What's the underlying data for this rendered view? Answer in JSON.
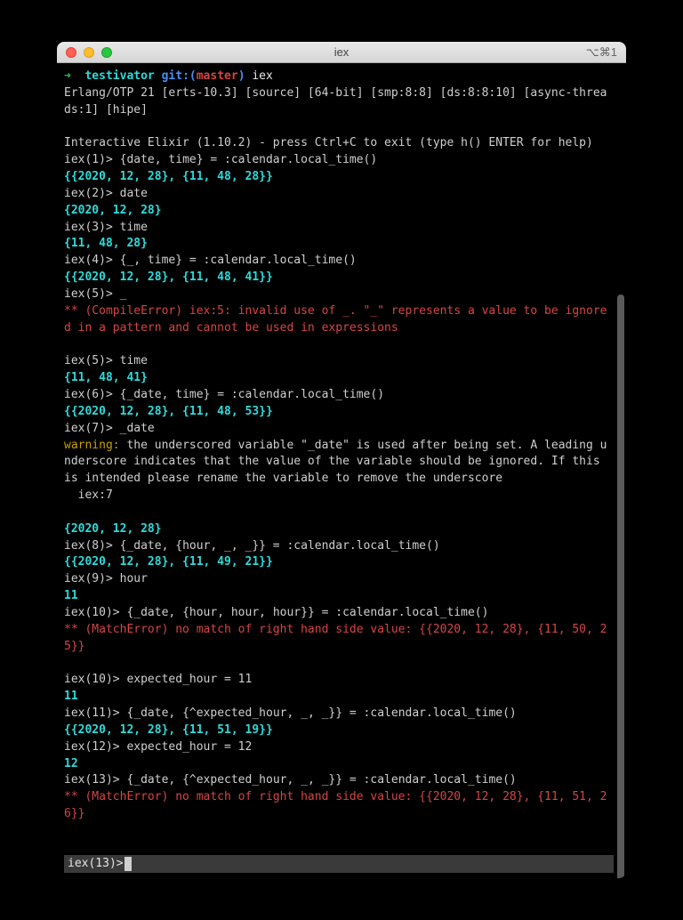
{
  "window": {
    "title": "iex",
    "shortcut": "⌥⌘1"
  },
  "ps1": {
    "arrow": "➜",
    "dir": "testivator",
    "git_prefix": "git:(",
    "branch": "master",
    "git_suffix": ")",
    "cmd": "iex"
  },
  "banner1": "Erlang/OTP 21 [erts-10.3] [source] [64-bit] [smp:8:8] [ds:8:8:10] [async-threads:1] [hipe]",
  "banner2": "Interactive Elixir (1.10.2) - press Ctrl+C to exit (type h() ENTER for help)",
  "l1": {
    "p": "iex(1)> ",
    "c": "{date, time} = :calendar.local_time()"
  },
  "r1": "{{2020, 12, 28}, {11, 48, 28}}",
  "l2": {
    "p": "iex(2)> ",
    "c": "date"
  },
  "r2": "{2020, 12, 28}",
  "l3": {
    "p": "iex(3)> ",
    "c": "time"
  },
  "r3": "{11, 48, 28}",
  "l4": {
    "p": "iex(4)> ",
    "c": "{_, time} = :calendar.local_time()"
  },
  "r4": "{{2020, 12, 28}, {11, 48, 41}}",
  "l5": {
    "p": "iex(5)> ",
    "c": "_"
  },
  "err5": "** (CompileError) iex:5: invalid use of _. \"_\" represents a value to be ignored in a pattern and cannot be used in expressions",
  "l5b": {
    "p": "iex(5)> ",
    "c": "time"
  },
  "r5b": "{11, 48, 41}",
  "l6": {
    "p": "iex(6)> ",
    "c": "{_date, time} = :calendar.local_time()"
  },
  "r6": "{{2020, 12, 28}, {11, 48, 53}}",
  "l7": {
    "p": "iex(7)> ",
    "c": "_date"
  },
  "warn7_label": "warning:",
  "warn7_text": " the underscored variable \"_date\" is used after being set. A leading underscore indicates that the value of the variable should be ignored. If this is intended please rename the variable to remove the underscore",
  "warn7_loc": "  iex:7",
  "r7": "{2020, 12, 28}",
  "l8": {
    "p": "iex(8)> ",
    "c": "{_date, {hour, _, _}} = :calendar.local_time()"
  },
  "r8": "{{2020, 12, 28}, {11, 49, 21}}",
  "l9": {
    "p": "iex(9)> ",
    "c": "hour"
  },
  "r9": "11",
  "l10": {
    "p": "iex(10)> ",
    "c": "{_date, {hour, hour, hour}} = :calendar.local_time()"
  },
  "err10": "** (MatchError) no match of right hand side value: {{2020, 12, 28}, {11, 50, 25}}",
  "l10b": {
    "p": "iex(10)> ",
    "c": "expected_hour = 11"
  },
  "r10b": "11",
  "l11": {
    "p": "iex(11)> ",
    "c": "{_date, {^expected_hour, _, _}} = :calendar.local_time()"
  },
  "r11": "{{2020, 12, 28}, {11, 51, 19}}",
  "l12": {
    "p": "iex(12)> ",
    "c": "expected_hour = 12"
  },
  "r12": "12",
  "l13": {
    "p": "iex(13)> ",
    "c": "{_date, {^expected_hour, _, _}} = :calendar.local_time()"
  },
  "err13": "** (MatchError) no match of right hand side value: {{2020, 12, 28}, {11, 51, 26}}",
  "status_prompt": "iex(13)> "
}
